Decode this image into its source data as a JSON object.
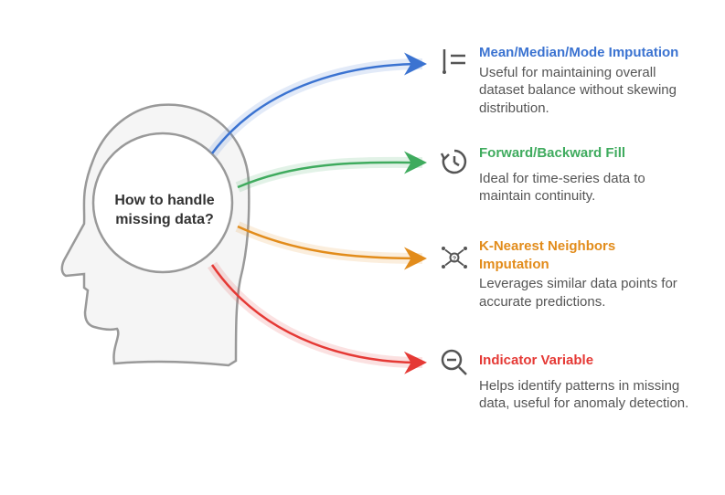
{
  "center": {
    "question": "How to handle missing data?"
  },
  "branches": [
    {
      "title": "Mean/Median/Mode Imputation",
      "desc": "Useful for maintaining overall dataset balance without skewing distribution.",
      "color": "#3b73d1",
      "icon": "not-equal-icon"
    },
    {
      "title": "Forward/Backward Fill",
      "desc": "Ideal for time-series data to maintain continuity.",
      "color": "#3fab5e",
      "icon": "history-icon"
    },
    {
      "title": "K-Nearest Neighbors Imputation",
      "desc": "Leverages similar data points for accurate predictions.",
      "color": "#e28c1b",
      "icon": "knn-icon"
    },
    {
      "title": "Indicator Variable",
      "desc": "Helps identify patterns in missing data, useful for anomaly detection.",
      "color": "#e53935",
      "icon": "minus-search-icon"
    }
  ]
}
